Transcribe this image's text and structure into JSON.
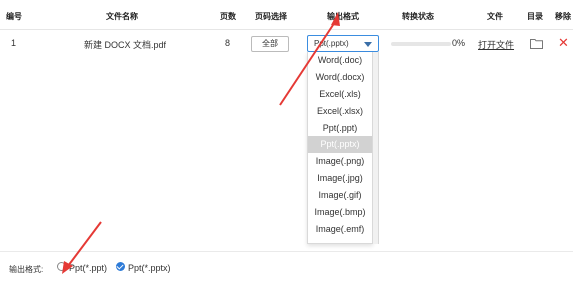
{
  "header": {
    "index": "编号",
    "filename": "文件名称",
    "pages": "页数",
    "page_select": "页码选择",
    "output_format": "输出格式",
    "status": "转换状态",
    "file": "文件",
    "folder": "目录",
    "remove": "移除"
  },
  "row": {
    "index": "1",
    "filename": "新建 DOCX 文档.pdf",
    "pages": "8",
    "page_button": "全部",
    "format_value": "Ppt(.pptx)",
    "progress_text": "0%",
    "progress_fraction": 0,
    "open_link": "打开文件",
    "remove_glyph": "✕"
  },
  "dropdown": {
    "options": [
      "Word(.doc)",
      "Word(.docx)",
      "Excel(.xls)",
      "Excel(.xlsx)",
      "Ppt(.ppt)",
      "Ppt(.pptx)",
      "Image(.png)",
      "Image(.jpg)",
      "Image(.gif)",
      "Image(.bmp)",
      "Image(.emf)"
    ],
    "selected_index": 5
  },
  "footer": {
    "label": "输出格式:",
    "option_ppt": "Ppt(*.ppt)",
    "option_pptx": "Ppt(*.pptx)"
  },
  "colors": {
    "accent": "#2d7bd8",
    "annotation_arrow": "#e53935",
    "remove_icon": "#e53935"
  }
}
